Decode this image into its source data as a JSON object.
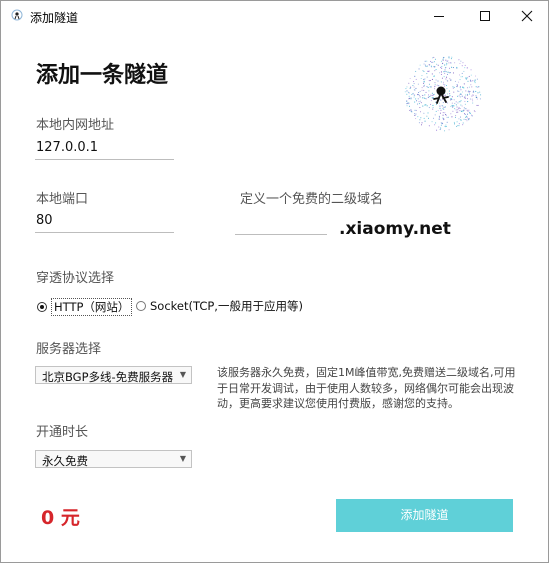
{
  "window": {
    "title": "添加隧道"
  },
  "heading": "添加一条隧道",
  "local_address": {
    "label": "本地内网地址",
    "value": "127.0.0.1"
  },
  "local_port": {
    "label": "本地端口",
    "value": "80"
  },
  "subdomain": {
    "label": "定义一个免费的二级域名",
    "value": "",
    "suffix": ".xiaomy.net"
  },
  "protocol": {
    "label": "穿透协议选择",
    "options": [
      {
        "label": "HTTP（网站）",
        "selected": true
      },
      {
        "label": "Socket(TCP,一般用于应用等)",
        "selected": false
      }
    ]
  },
  "server": {
    "label": "服务器选择",
    "selected": "北京BGP多线-免费服务器",
    "description": "该服务器永久免费，固定1M峰值带宽,免费赠送二级域名,可用于日常开发调试，由于使用人数较多，网络偶尔可能会出现波动，更高要求建议您使用付费版，感谢您的支持。"
  },
  "duration": {
    "label": "开通时长",
    "selected": "永久免费"
  },
  "price": "0 元",
  "submit_label": "添加隧道",
  "colors": {
    "accent": "#5fd0d8",
    "price": "#d6262b"
  }
}
